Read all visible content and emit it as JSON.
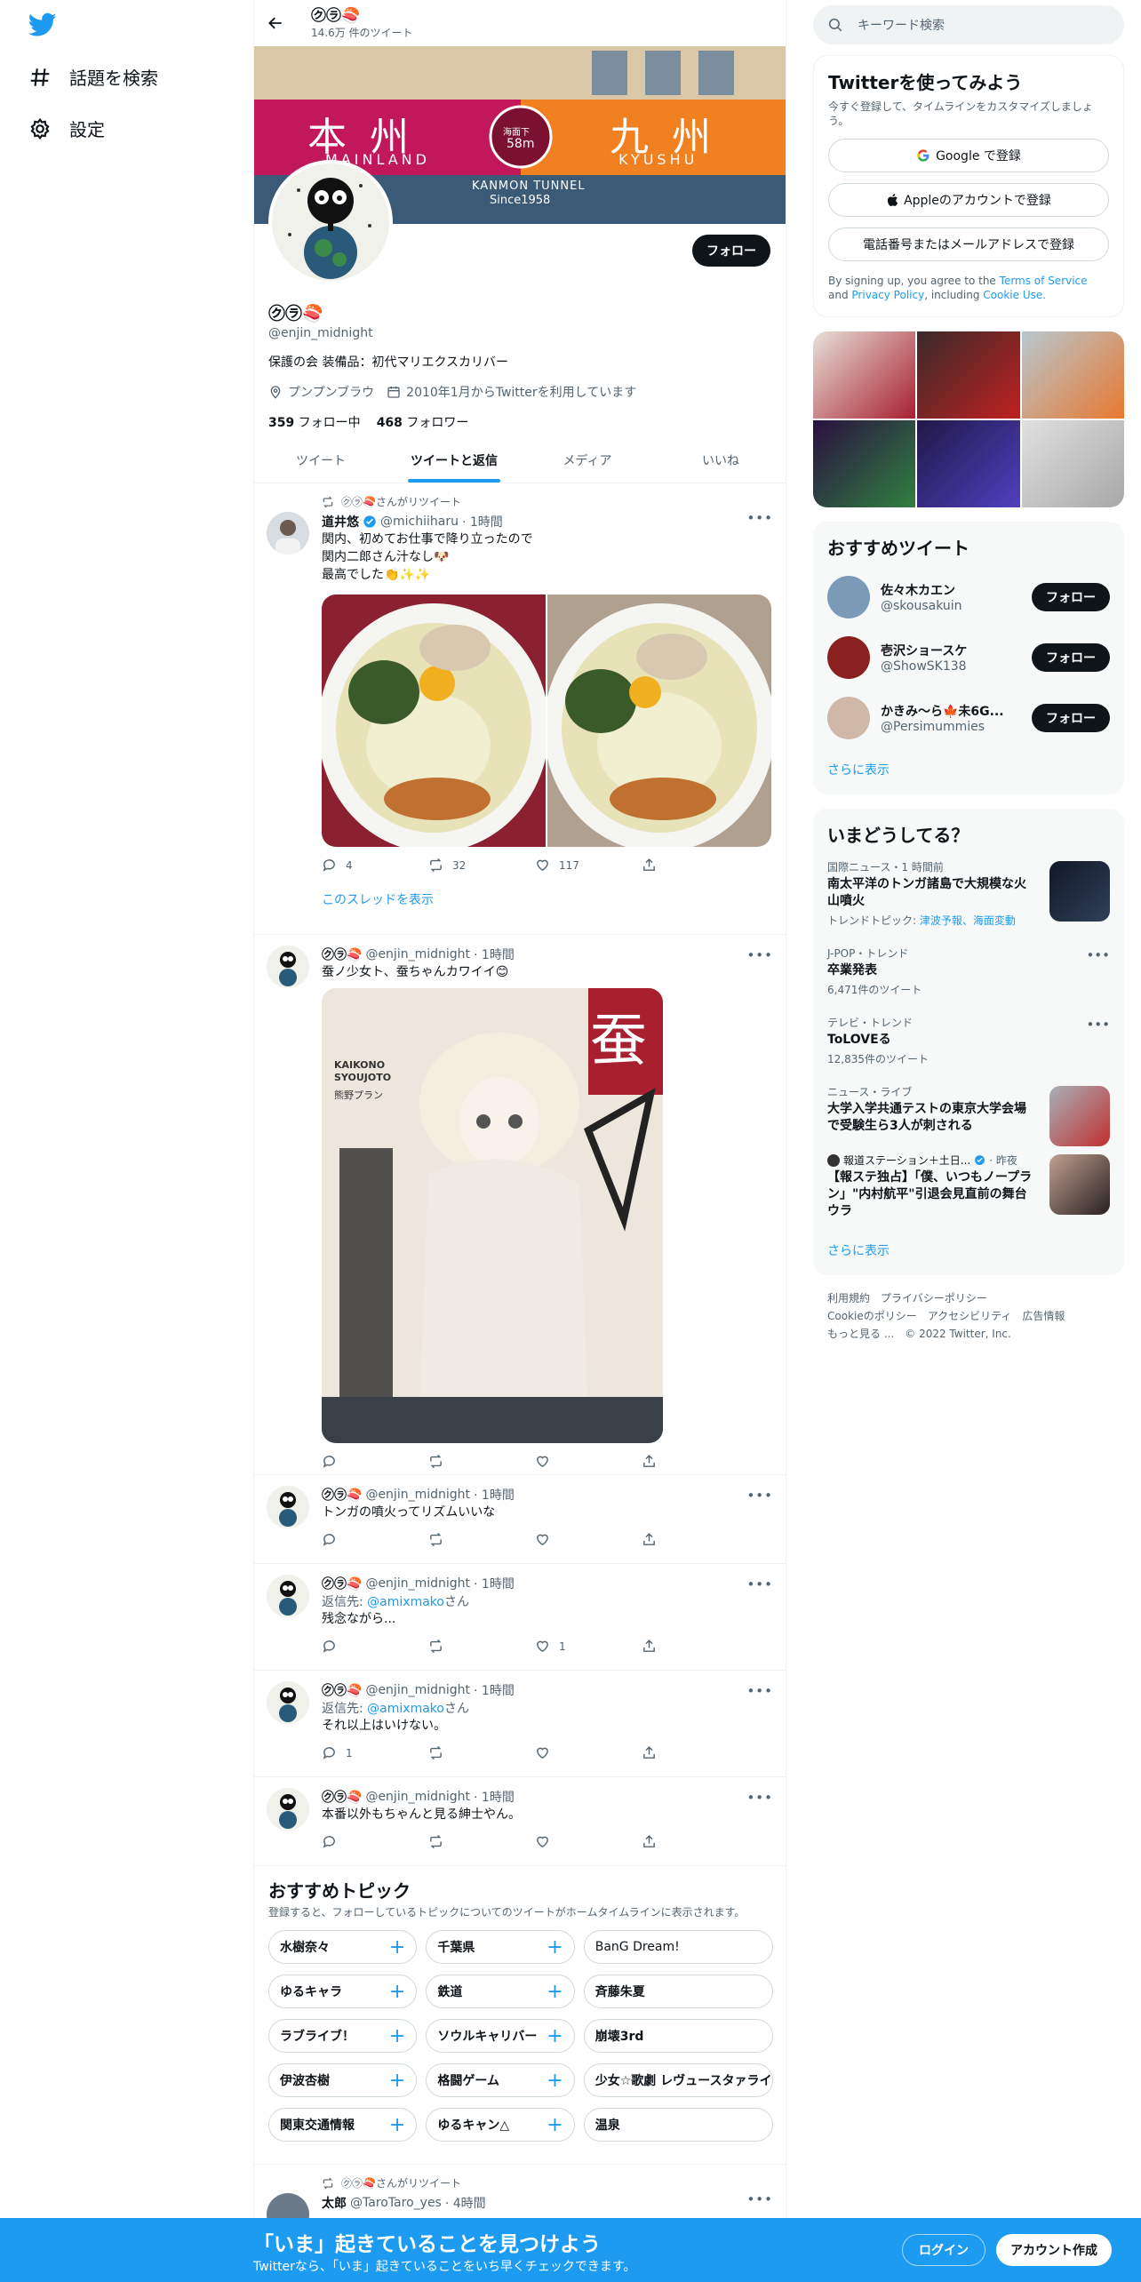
{
  "nav": {
    "explore_label": "話題を検索",
    "settings_label": "設定"
  },
  "profile": {
    "header_name": "㋗㋶🍣",
    "tweet_count": "14.6万 件のツイート",
    "banner_left_kanji": "本州",
    "banner_left_roman": "MAINLAND",
    "banner_right_kanji": "九州",
    "banner_right_roman": "KYUSHU",
    "banner_circle_top": "海面下",
    "banner_circle_bottom": "58m",
    "banner_tunnel": "KANMON TUNNEL",
    "banner_since": "Since1958",
    "follow_label": "フォロー",
    "name": "㋗㋶🍣",
    "handle": "@enjin_midnight",
    "bio": "保護の会 装備品：初代マリエクスカリバー",
    "location": "プンプンブラウ",
    "joined": "2010年1月からTwitterを利用しています",
    "following_count": "359",
    "following_label": "フォロー中",
    "followers_count": "468",
    "followers_label": "フォロワー"
  },
  "tabs": [
    {
      "label": "ツイート",
      "active": false
    },
    {
      "label": "ツイートと返信",
      "active": true
    },
    {
      "label": "メディア",
      "active": false
    },
    {
      "label": "いいね",
      "active": false
    }
  ],
  "tweets": {
    "t1": {
      "retweet_label": "㋗㋶🍣さんがリツイート",
      "name": "道井悠",
      "handle": "@michiiharu",
      "time": "· 1時間",
      "line1": "関内、初めてお仕事で降り立ったので",
      "line2": "関内二郎さん汁なし🐶",
      "line3": "最高でした👏✨✨",
      "replies": "4",
      "retweets": "32",
      "likes": "117",
      "thread_label": "このスレッドを表示"
    },
    "t2": {
      "name": "㋗㋶🍣",
      "handle": "@enjin_midnight",
      "time": "· 1時間",
      "text": "蚕ノ少女ト、蚕ちゃんカワイイ😊",
      "img_text_big": "蚕",
      "img_text_small": "KAIKONO SYOUJOTO",
      "img_text_jp": "熊野プラン"
    },
    "t3": {
      "name": "㋗㋶🍣",
      "handle": "@enjin_midnight",
      "time": "· 1時間",
      "text": "トンガの噴火ってリズムいいな"
    },
    "t4": {
      "name": "㋗㋶🍣",
      "handle": "@enjin_midnight",
      "time": "· 1時間",
      "reply_prefix": "返信先:",
      "reply_to": "@amixmako",
      "reply_suffix": "さん",
      "text": "残念ながら...",
      "likes": "1"
    },
    "t5": {
      "name": "㋗㋶🍣",
      "handle": "@enjin_midnight",
      "time": "· 1時間",
      "reply_prefix": "返信先:",
      "reply_to": "@amixmako",
      "reply_suffix": "さん",
      "text": "それ以上はいけない。",
      "replies": "1"
    },
    "t6": {
      "name": "㋗㋶🍣",
      "handle": "@enjin_midnight",
      "time": "· 1時間",
      "text": "本番以外もちゃんと見る紳士やん。"
    },
    "t7": {
      "retweet_label": "㋗㋶🍣さんがリツイート",
      "name": "太郎",
      "handle": "@TaroTaro_yes",
      "time": "· 4時間"
    }
  },
  "topics": {
    "title": "おすすめトピック",
    "subtitle": "登録すると、フォローしているトピックについてのツイートがホームタイムラインに表示されます。",
    "rows": [
      [
        "水樹奈々",
        "千葉県",
        "BanG Dream!"
      ],
      [
        "ゆるキャラ",
        "鉄道",
        "斉藤朱夏"
      ],
      [
        "ラブライブ！",
        "ソウルキャリバー",
        "崩壊3rd"
      ],
      [
        "伊波杏樹",
        "格闘ゲーム",
        "少女☆歌劇 レヴュースタァライト"
      ],
      [
        "関東交通情報",
        "ゆるキャン△",
        "温泉"
      ]
    ]
  },
  "sidebar": {
    "search_placeholder": "キーワード検索",
    "signup": {
      "title": "Twitterを使ってみよう",
      "subtitle": "今すぐ登録して、タイムラインをカスタマイズしましょう。",
      "google": "Google で登録",
      "apple": "Appleのアカウントで登録",
      "phone": "電話番号またはメールアドレスで登録",
      "legal_1": "By signing up, you agree to the",
      "terms": "Terms of Service",
      "legal_2": "and",
      "privacy": "Privacy Policy",
      "legal_3": ", including",
      "cookie": "Cookie Use."
    },
    "who": {
      "title": "おすすめツイート",
      "users": [
        {
          "name": "佐々木カエン",
          "handle": "@skousakuin",
          "follow": "フォロー"
        },
        {
          "name": "壱沢ショースケ",
          "handle": "@ShowSK138",
          "follow": "フォロー"
        },
        {
          "name": "かきみ～ら🍁未6G...",
          "handle": "@Persimummies",
          "follow": "フォロー"
        }
      ],
      "more": "さらに表示"
    },
    "trends": {
      "title": "いまどうしてる？",
      "items": [
        {
          "cat": "国際ニュース・1 時間前",
          "title": "南太平洋のトンガ諸島で大規模な火山噴火",
          "extra_label": "トレンドトピック:",
          "extra_links": "津波予報、海面変動"
        },
        {
          "cat": "J-POP・トレンド",
          "title": "卒業発表",
          "count": "6,471件のツイート"
        },
        {
          "cat": "テレビ・トレンド",
          "title": "ToLOVEる",
          "count": "12,835件のツイート"
        },
        {
          "cat": "ニュース・ライブ",
          "title": "大学入学共通テストの東京大学会場で受験生ら3人が刺される"
        },
        {
          "cat": "報道ステーション＋土日...",
          "time": "· 昨夜",
          "title": "【報ステ独占】「僕、いつもノープラン」\"内村航平\"引退会見直前の舞台ウラ"
        }
      ],
      "more": "さらに表示"
    },
    "footer": {
      "links": [
        "利用規約",
        "プライバシーポリシー",
        "Cookieのポリシー",
        "アクセシビリティ",
        "広告情報",
        "もっと見る ...",
        "© 2022 Twitter, Inc."
      ]
    }
  },
  "bottom_bar": {
    "headline": "「いま」起きていることを見つけよう",
    "sub": "Twitterなら、「いま」起きていることをいち早くチェックできます。",
    "login": "ログイン",
    "signup": "アカウント作成"
  },
  "colors": {
    "accent": "#1d9bf0",
    "text": "#0f1419",
    "muted": "#536471",
    "banner_magenta": "#c2185b",
    "banner_orange": "#f08020"
  }
}
